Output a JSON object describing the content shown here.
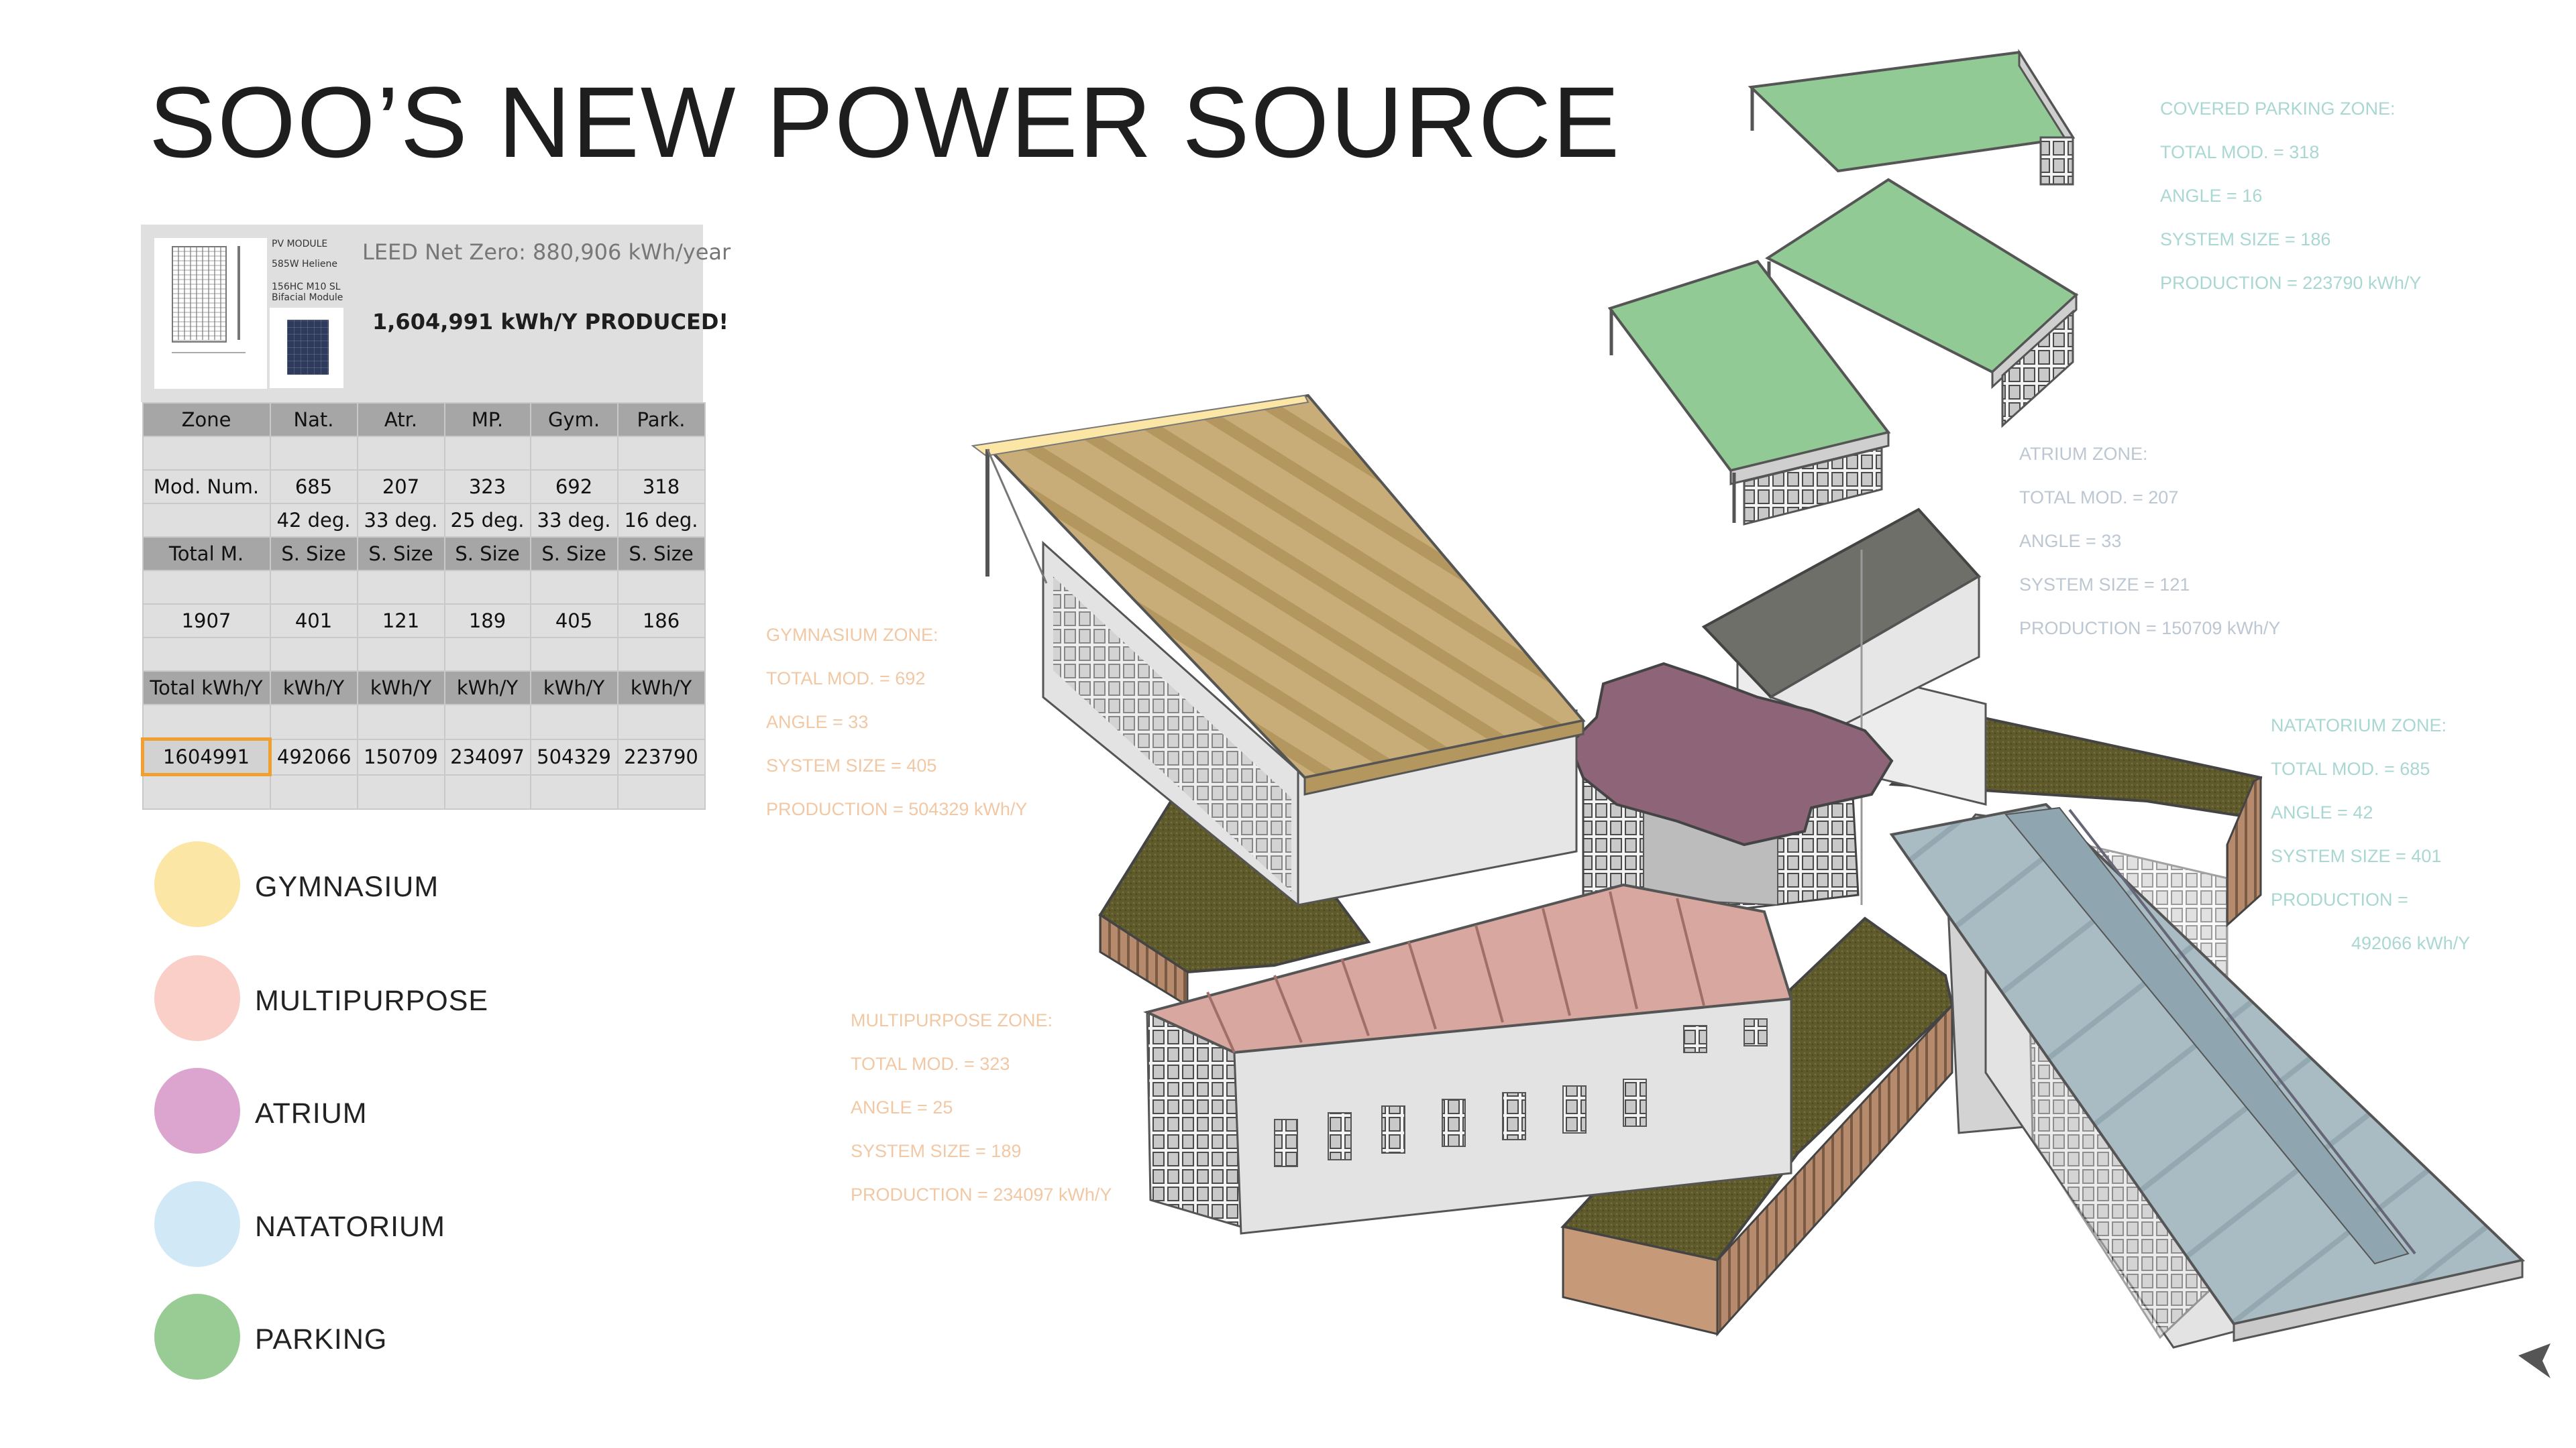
{
  "title": "SOO’S NEW POWER SOURCE",
  "pv_module": {
    "spec_lines": [
      "PV MODULE",
      "585W Heliene",
      "156HC M10 SL Bifacial Module"
    ],
    "leed": "LEED Net Zero: 880,906 kWh/year",
    "produced": "1,604,991 kWh/Y PRODUCED!"
  },
  "table": {
    "rows": [
      [
        "Zone",
        "Nat.",
        "Atr.",
        "MP.",
        "Gym.",
        "Park."
      ],
      [
        "",
        "",
        "",
        "",
        "",
        ""
      ],
      [
        "Mod. Num.",
        "685",
        "207",
        "323",
        "692",
        "318"
      ],
      [
        "",
        "42 deg.",
        "33 deg.",
        "25 deg.",
        "33 deg.",
        "16 deg."
      ],
      [
        "Total M.",
        "S. Size",
        "S. Size",
        "S. Size",
        "S. Size",
        "S. Size"
      ],
      [
        "",
        "",
        "",
        "",
        "",
        ""
      ],
      [
        "1907",
        "401",
        "121",
        "189",
        "405",
        "186"
      ],
      [
        "",
        "",
        "",
        "",
        "",
        ""
      ],
      [
        "Total kWh/Y",
        "kWh/Y",
        "kWh/Y",
        "kWh/Y",
        "kWh/Y",
        "kWh/Y"
      ],
      [
        "",
        "",
        "",
        "",
        "",
        ""
      ],
      [
        "1604991",
        "492066",
        "150709",
        "234097",
        "504329",
        "223790"
      ],
      [
        "",
        "",
        "",
        "",
        "",
        ""
      ]
    ]
  },
  "legend": [
    {
      "label": "GYMNASIUM",
      "color": "#fbe6a6"
    },
    {
      "label": "MULTIPURPOSE",
      "color": "#f9cfc8"
    },
    {
      "label": "ATRIUM",
      "color": "#dba5cf"
    },
    {
      "label": "NATATORIUM",
      "color": "#d1e8f6"
    },
    {
      "label": "PARKING",
      "color": "#98cc94"
    }
  ],
  "zones": {
    "parking": {
      "color": "#a9d7d2",
      "lines": [
        "COVERED PARKING ZONE:",
        "TOTAL MOD. = 318",
        "ANGLE = 16",
        "SYSTEM SIZE = 186",
        "PRODUCTION = 223790  kWh/Y"
      ]
    },
    "atrium": {
      "color": "#bcc7d2",
      "lines": [
        "ATRIUM ZONE:",
        "TOTAL MOD. =  207",
        "ANGLE = 33",
        "SYSTEM SIZE = 121",
        "PRODUCTION = 150709 kWh/Y"
      ]
    },
    "gymnasium": {
      "color": "#f2c8a4",
      "lines": [
        "GYMNASIUM ZONE:",
        "TOTAL MOD. = 692",
        "ANGLE = 33",
        "SYSTEM SIZE = 405",
        "PRODUCTION = 504329 kWh/Y"
      ]
    },
    "natatorium": {
      "color": "#a9d7d2",
      "lines": [
        "NATATORIUM ZONE:",
        "TOTAL MOD. = 685",
        "ANGLE = 42",
        "SYSTEM SIZE = 401",
        "PRODUCTION =",
        "492066 kWh/Y"
      ]
    },
    "multipurpose": {
      "color": "#f2c8a4",
      "lines": [
        "MULTIPURPOSE ZONE:",
        "TOTAL MOD. = 323",
        "ANGLE = 25",
        "SYSTEM SIZE = 189",
        "PRODUCTION = 234097 kWh/Y"
      ]
    }
  },
  "colors": {
    "gym_roof": "#c9ad79",
    "mp_roof": "#d8a8a0",
    "atrium_roof": "#8e6479",
    "nat_roof": "#a9bcc3",
    "parking_roof": "#92ca95",
    "green_roof": "#5e5a2c",
    "wall": "#e2e2e2",
    "brick": "#b68a6c",
    "slate": "#6f6f6a"
  }
}
